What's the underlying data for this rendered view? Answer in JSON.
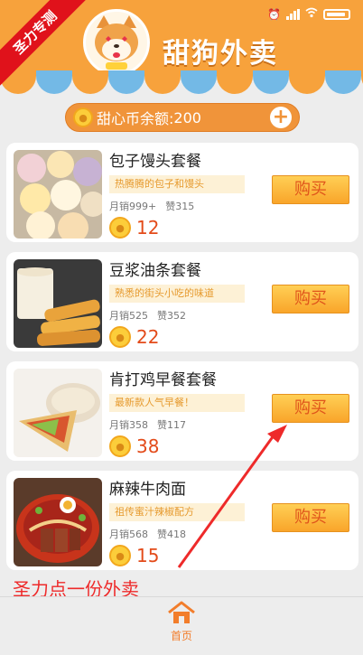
{
  "app": {
    "title": "甜狗外卖"
  },
  "ribbon": {
    "text": "圣力专测"
  },
  "balance": {
    "label": "甜心币余额:",
    "value": "200"
  },
  "products": [
    {
      "name": "包子馒头套餐",
      "desc": "热腾腾的包子和馒头",
      "monthly_sales": "月销999+",
      "likes": "赞315",
      "price": "12",
      "buy_label": "购买"
    },
    {
      "name": "豆浆油条套餐",
      "desc": "熟悉的街头小吃的味道",
      "monthly_sales": "月销525",
      "likes": "赞352",
      "price": "22",
      "buy_label": "购买"
    },
    {
      "name": "肯打鸡早餐套餐",
      "desc": "最新款人气早餐！",
      "monthly_sales": "月销358",
      "likes": "赞117",
      "price": "38",
      "buy_label": "购买"
    },
    {
      "name": "麻辣牛肉面",
      "desc": "祖传蜜汁辣椒配方",
      "monthly_sales": "月销568",
      "likes": "赞418",
      "price": "15",
      "buy_label": "购买"
    }
  ],
  "annotation": {
    "text": "圣力点一份外卖"
  },
  "nav": {
    "home_label": "首页"
  },
  "colors": {
    "header": "#f7a23c",
    "accent": "#e34b1a",
    "ribbon": "#e0121b"
  },
  "icons": [
    "dog-logo",
    "coin-icon",
    "plus-icon",
    "home-icon",
    "alarm-icon",
    "signal-icon",
    "wifi-icon",
    "battery-icon"
  ]
}
